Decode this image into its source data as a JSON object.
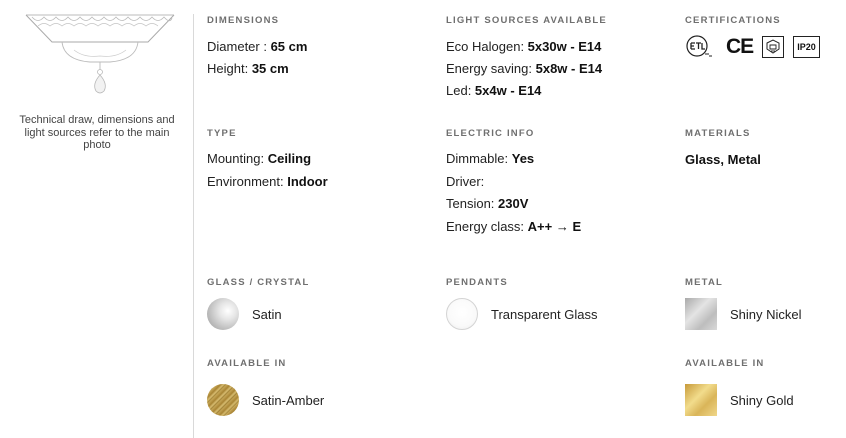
{
  "left": {
    "caption": "Technical draw, dimensions and light sources refer to the main photo"
  },
  "dimensions": {
    "title": "DIMENSIONS",
    "rows": [
      {
        "label": "Diameter : ",
        "value": "65 cm"
      },
      {
        "label": "Height: ",
        "value": "35 cm"
      }
    ]
  },
  "light_sources": {
    "title": "LIGHT SOURCES AVAILABLE",
    "rows": [
      {
        "label": "Eco Halogen: ",
        "value": "5x30w - E14"
      },
      {
        "label": "Energy saving: ",
        "value": "5x8w - E14"
      },
      {
        "label": "Led: ",
        "value": "5x4w - E14"
      }
    ]
  },
  "certifications": {
    "title": "CERTIFICATIONS",
    "badges": [
      {
        "icon": "etl-listed-icon"
      },
      {
        "icon": "ce-mark-icon",
        "text": "CE"
      },
      {
        "icon": "class-ii-icon"
      },
      {
        "icon": "ip20-icon",
        "text": "IP20"
      }
    ]
  },
  "type": {
    "title": "TYPE",
    "rows": [
      {
        "label": "Mounting: ",
        "value": "Ceiling"
      },
      {
        "label": "Environment: ",
        "value": "Indoor"
      }
    ]
  },
  "electric": {
    "title": "ELECTRIC INFO",
    "rows": [
      {
        "label": "Dimmable: ",
        "value": "Yes"
      },
      {
        "label": "Driver: ",
        "value": ""
      },
      {
        "label": "Tension: ",
        "value": "230V"
      },
      {
        "label": "Energy class: ",
        "value": "A++ → E"
      }
    ]
  },
  "materials": {
    "title": "MATERIALS",
    "value": "Glass, Metal"
  },
  "glass_crystal": {
    "title": "GLASS / CRYSTAL",
    "selected": {
      "label": "Satin",
      "color": "#cfcfcf"
    },
    "available_title": "AVAILABLE IN",
    "available": [
      {
        "label": "Satin-Amber",
        "color": "#b8974a"
      }
    ]
  },
  "pendants": {
    "title": "PENDANTS",
    "selected": {
      "label": "Transparent Glass",
      "color": "#f6f6f6"
    }
  },
  "metal": {
    "title": "METAL",
    "selected": {
      "label": "Shiny Nickel",
      "color": "#c6c6c6"
    },
    "available_title": "AVAILABLE IN",
    "available": [
      {
        "label": "Shiny Gold",
        "color": "#d8b45a"
      }
    ]
  }
}
